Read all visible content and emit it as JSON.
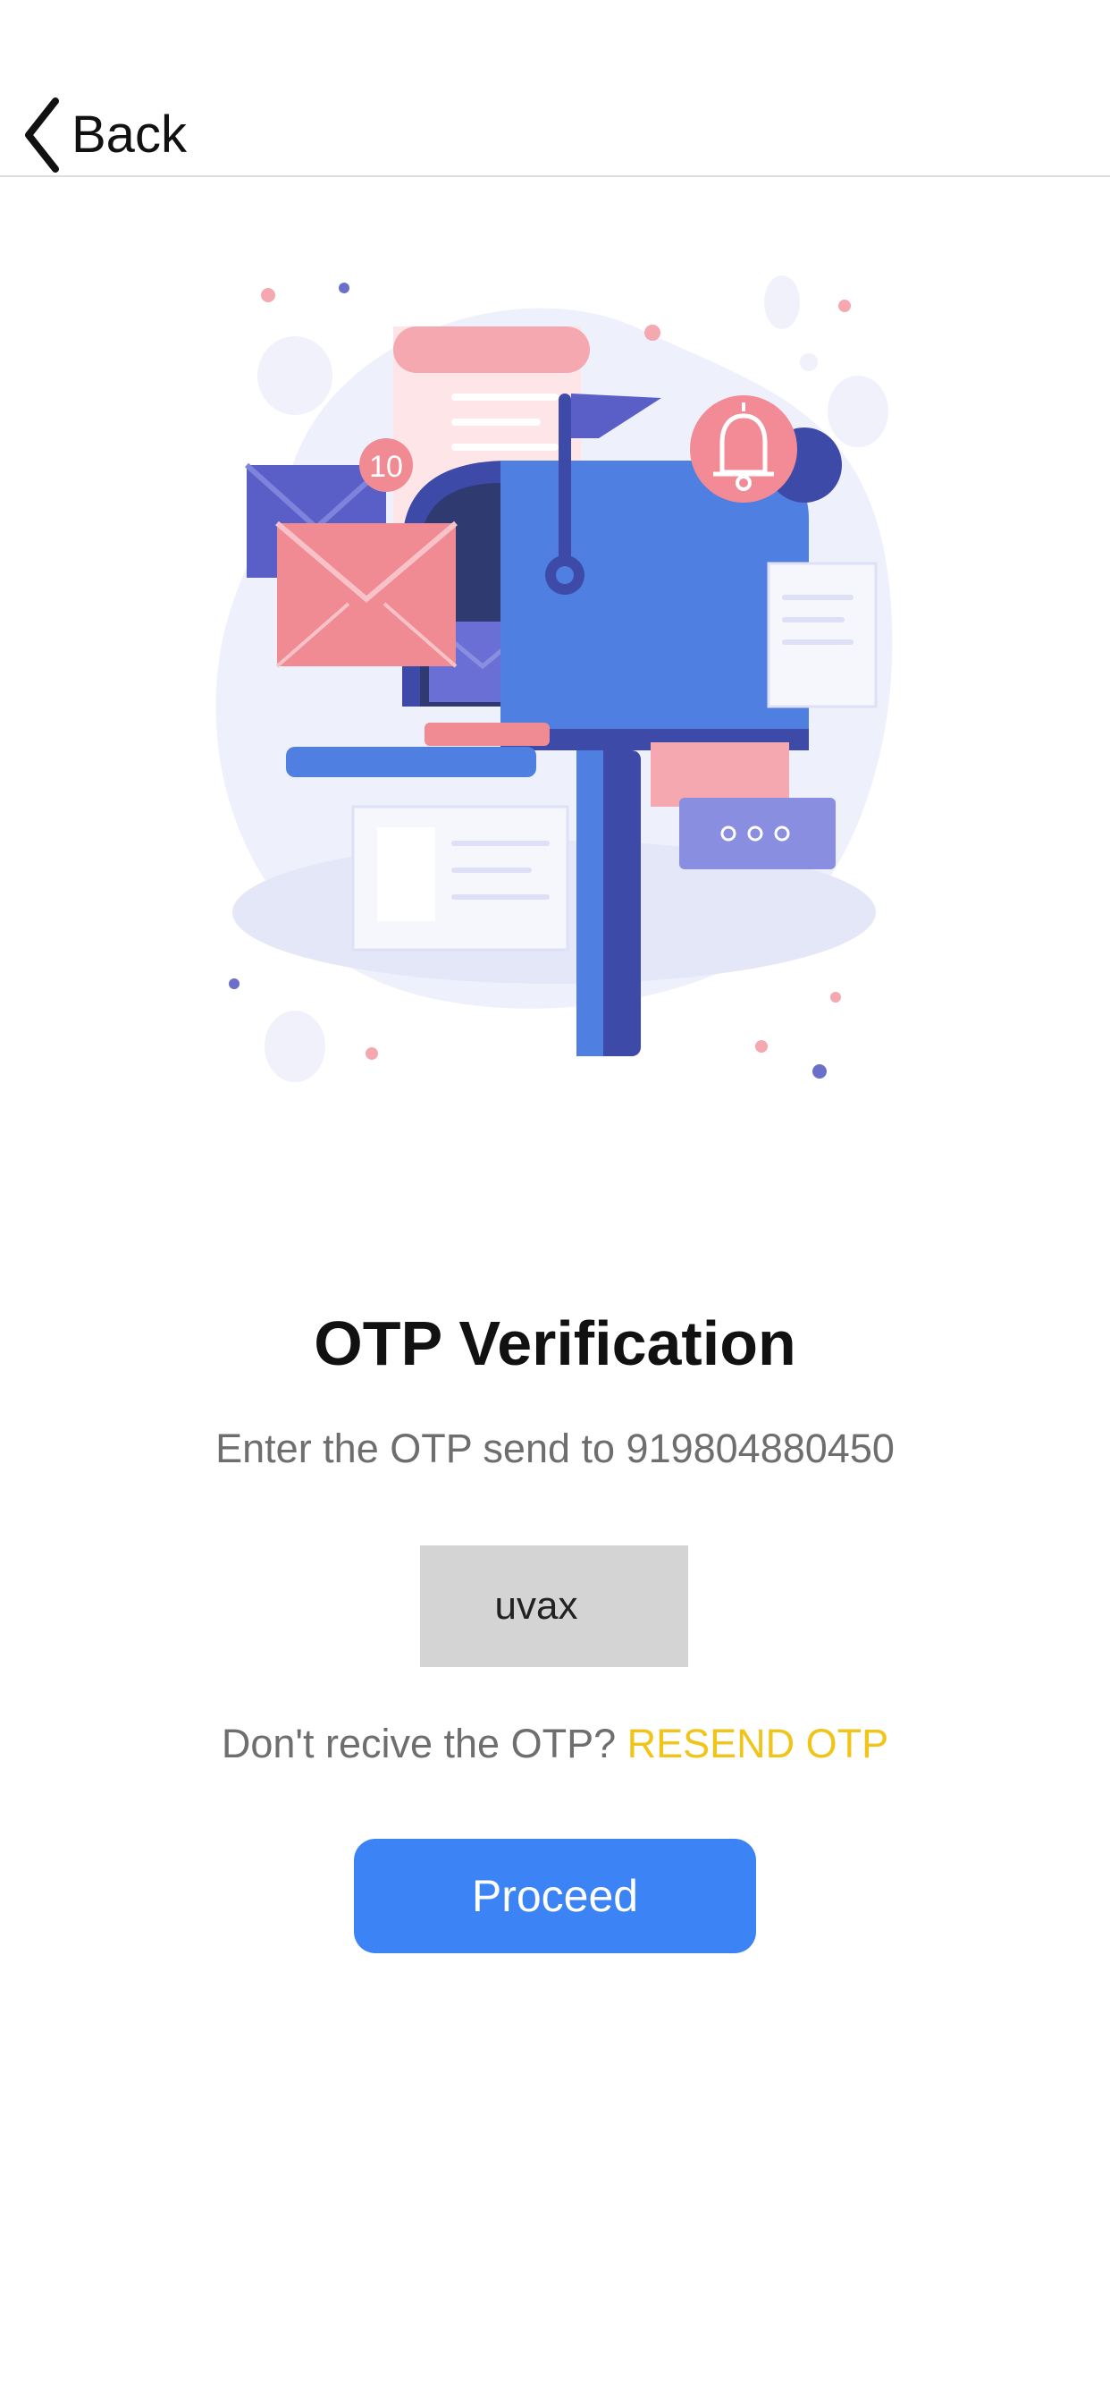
{
  "nav": {
    "back_label": "Back"
  },
  "illustration": {
    "icon": "mailbox-illustration",
    "badge_count": "10",
    "colors": {
      "blob": "#eef0fb",
      "mailbox_blue": "#4f7fe0",
      "mailbox_dark": "#3d4aa8",
      "envelope_pink": "#f08a93",
      "envelope_purple": "#5a5fc8",
      "bell_bg": "#f28b95"
    }
  },
  "main": {
    "title": "OTP Verification",
    "subtitle": "Enter the OTP send to 919804880450",
    "otp_value": "uvax",
    "resend_prompt": "Don't recive the OTP?",
    "resend_link": "RESEND OTP",
    "proceed_label": "Proceed"
  },
  "colors": {
    "accent": "#3c83f6",
    "resend": "#f0c419",
    "input_bg": "#d4d4d4",
    "muted_text": "#6e6e6e"
  }
}
